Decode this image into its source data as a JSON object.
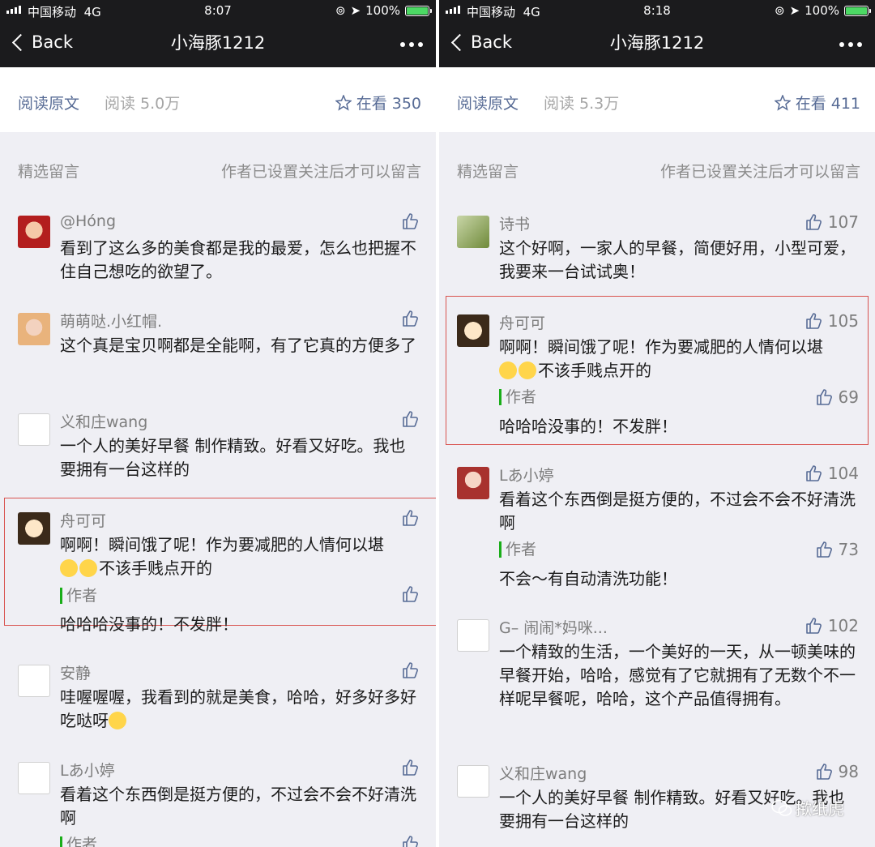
{
  "colors": {
    "nav_bg": "#1b1b1d",
    "link": "#576b95",
    "highlight": "#d9534f",
    "author_bar": "#1aad19",
    "battery": "#4cd964"
  },
  "left": {
    "status": {
      "carrier": "中国移动",
      "network": "4G",
      "time": "8:07",
      "battery": "100%"
    },
    "nav": {
      "back": "Back",
      "title": "小海豚1212"
    },
    "readbar": {
      "orig": "阅读原文",
      "reads": "阅读 5.0万",
      "watching": "在看 350"
    },
    "section": {
      "title": "精选留言",
      "note": "作者已设置关注后才可以留言"
    },
    "comments": [
      {
        "nick": "@Hóng",
        "text": "看到了这么多的美食都是我的最爱，怎么也把握不住自己想吃的欲望了。"
      },
      {
        "nick": "萌萌哒.小红帽.",
        "text": "这个真是宝贝啊都是全能啊，有了它真的方便多了"
      },
      {
        "nick": "义和庄wang",
        "text": "一个人的美好早餐 制作精致。好看又好吃。我也要拥有一台这样的"
      },
      {
        "nick": "舟可可",
        "text": "啊啊！瞬间饿了呢！作为要减肥的人情何以堪",
        "text2": "不该手贱点开的",
        "author_label": "作者",
        "reply": "哈哈哈没事的！不发胖！"
      },
      {
        "nick": "安静",
        "text": "哇喔喔喔，我看到的就是美食，哈哈，好多好多好吃哒呀"
      },
      {
        "nick": "Lあ小婷",
        "text": "看着这个东西倒是挺方便的，不过会不会不好清洗啊",
        "author_label": "作者"
      }
    ]
  },
  "right": {
    "status": {
      "carrier": "中国移动",
      "network": "4G",
      "time": "8:18",
      "battery": "100%"
    },
    "nav": {
      "back": "Back",
      "title": "小海豚1212"
    },
    "readbar": {
      "orig": "阅读原文",
      "reads": "阅读 5.3万",
      "watching": "在看 411"
    },
    "section": {
      "title": "精选留言",
      "note": "作者已设置关注后才可以留言"
    },
    "comments": [
      {
        "nick": "诗书",
        "likes": "107",
        "text": "这个好啊，一家人的早餐，简便好用，小型可爱，我要来一台试试奥！"
      },
      {
        "nick": "舟可可",
        "likes": "105",
        "text": "啊啊！瞬间饿了呢！作为要减肥的人情何以堪",
        "text2": "不该手贱点开的",
        "author_label": "作者",
        "author_likes": "69",
        "reply": "哈哈哈没事的！不发胖！"
      },
      {
        "nick": "Lあ小婷",
        "likes": "104",
        "text": "看着这个东西倒是挺方便的，不过会不会不好清洗啊",
        "author_label": "作者",
        "author_likes": "73",
        "reply": "不会～有自动清洗功能！"
      },
      {
        "nick": "G–   闹闹*妈咪...",
        "likes": "102",
        "text": "一个精致的生活，一个美好的一天，从一顿美味的早餐开始，哈哈，感觉有了它就拥有了无数个不一样呢早餐呢，哈哈，这个产品值得拥有。"
      },
      {
        "nick": "义和庄wang",
        "likes": "98",
        "text": "一个人的美好早餐 制作精致。好看又好吃。我也要拥有一台这样的"
      }
    ]
  },
  "watermark": "揿纸虎"
}
